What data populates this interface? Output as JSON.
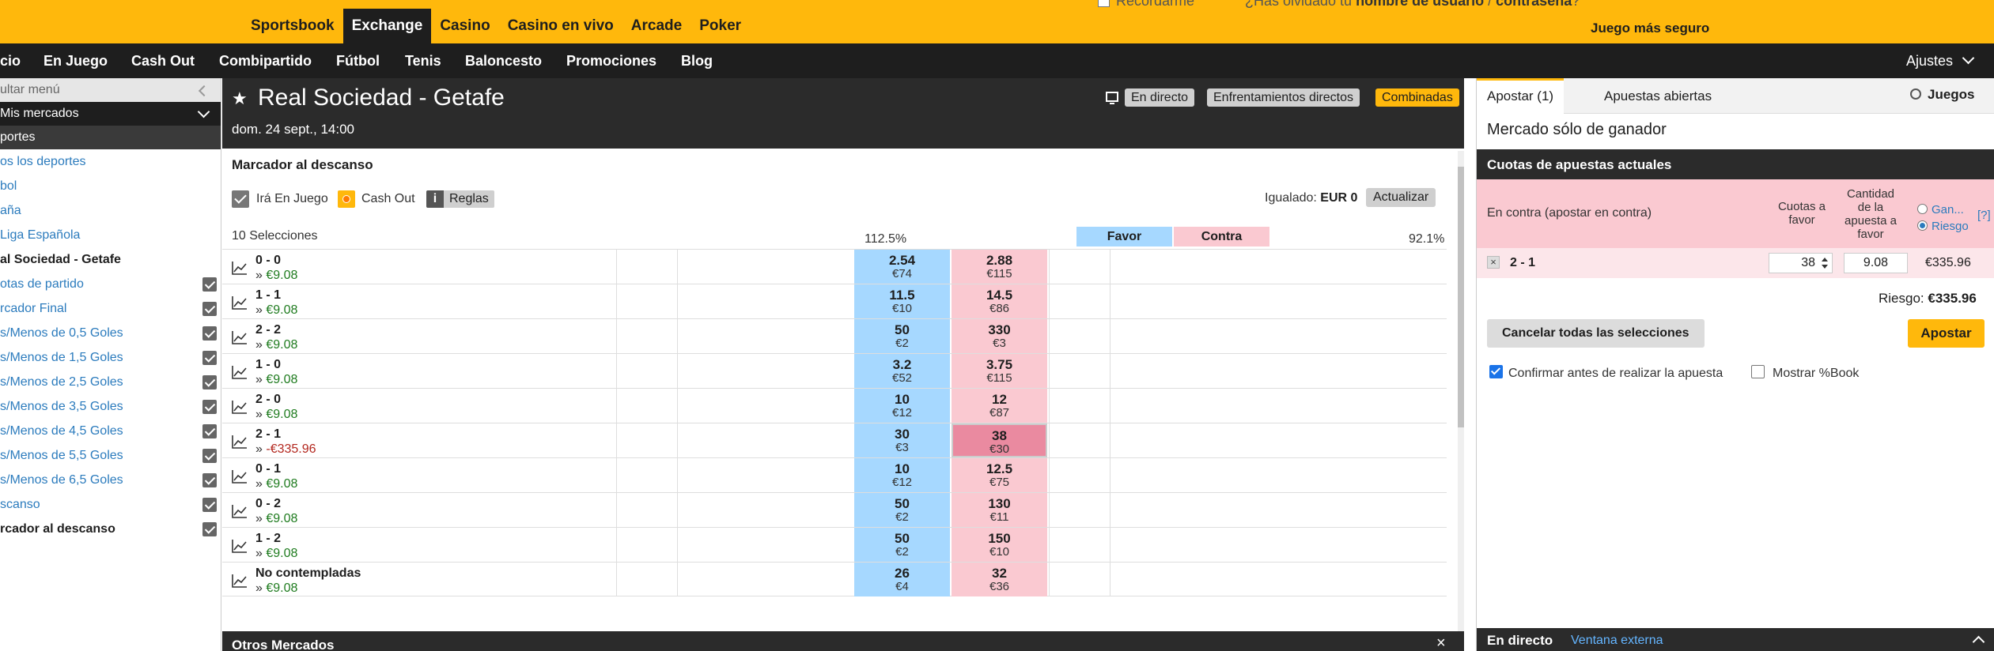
{
  "header": {
    "products": [
      "Sportsbook",
      "Exchange",
      "Casino",
      "Casino en vivo",
      "Arcade",
      "Poker"
    ],
    "active_product": "Exchange",
    "remember_me": "Recordarme",
    "forgot_prefix": "¿Has olvidado tu",
    "forgot_bold_1": "nombre de usuario",
    "forgot_sep": "/",
    "forgot_bold_2": "contraseña",
    "forgot_end": "?",
    "safer_gambling": "Juego más seguro"
  },
  "nav": {
    "items": [
      "cio",
      "En Juego",
      "Cash Out",
      "Combipartido",
      "Fútbol",
      "Tenis",
      "Baloncesto",
      "Promociones",
      "Blog"
    ],
    "settings": "Ajustes"
  },
  "sidebar": {
    "hide_menu": "ultar menú",
    "my_markets": "Mis mercados",
    "sports_header": "portes",
    "items": [
      {
        "label": "os los deportes",
        "checked": false,
        "bold": false
      },
      {
        "label": "bol",
        "checked": false,
        "bold": false
      },
      {
        "label": "aña",
        "checked": false,
        "bold": false
      },
      {
        "label": "Liga Española",
        "checked": false,
        "bold": false
      },
      {
        "label": "al Sociedad - Getafe",
        "checked": false,
        "bold": true
      },
      {
        "label": "otas de partido",
        "checked": true,
        "bold": false
      },
      {
        "label": "rcador Final",
        "checked": true,
        "bold": false
      },
      {
        "label": "s/Menos de 0,5 Goles",
        "checked": true,
        "bold": false
      },
      {
        "label": "s/Menos de 1,5 Goles",
        "checked": true,
        "bold": false
      },
      {
        "label": "s/Menos de 2,5 Goles",
        "checked": true,
        "bold": false
      },
      {
        "label": "s/Menos de 3,5 Goles",
        "checked": true,
        "bold": false
      },
      {
        "label": "s/Menos de 4,5 Goles",
        "checked": true,
        "bold": false
      },
      {
        "label": "s/Menos de 5,5 Goles",
        "checked": true,
        "bold": false
      },
      {
        "label": "s/Menos de 6,5 Goles",
        "checked": true,
        "bold": false
      },
      {
        "label": "scanso",
        "checked": true,
        "bold": false
      },
      {
        "label": "rcador al descanso",
        "checked": true,
        "bold": true
      }
    ]
  },
  "event": {
    "title": "Real Sociedad - Getafe",
    "date": "dom. 24 sept., 14:00",
    "buttons": {
      "live": "En directo",
      "h2h": "Enfrentamientos directos",
      "multiples": "Combinadas"
    }
  },
  "market": {
    "name": "Marcador al descanso",
    "in_play": "Irá En Juego",
    "cash_out": "Cash Out",
    "rules_icon": "i",
    "rules": "Reglas",
    "matched_label": "Igualado:",
    "matched_value": "EUR 0",
    "refresh": "Actualizar",
    "selections_count": "10 Selecciones",
    "back_overround": "112.5%",
    "lay_overround": "92.1%",
    "back_header": "Favor",
    "lay_header": "Contra",
    "runners": [
      {
        "name": "0 - 0",
        "pl": "€9.08",
        "pl_negative": false,
        "back_odds": "2.54",
        "back_size": "€74",
        "lay_odds": "2.88",
        "lay_size": "€115",
        "lay_selected": false
      },
      {
        "name": "1 - 1",
        "pl": "€9.08",
        "pl_negative": false,
        "back_odds": "11.5",
        "back_size": "€10",
        "lay_odds": "14.5",
        "lay_size": "€86",
        "lay_selected": false
      },
      {
        "name": "2 - 2",
        "pl": "€9.08",
        "pl_negative": false,
        "back_odds": "50",
        "back_size": "€2",
        "lay_odds": "330",
        "lay_size": "€3",
        "lay_selected": false
      },
      {
        "name": "1 - 0",
        "pl": "€9.08",
        "pl_negative": false,
        "back_odds": "3.2",
        "back_size": "€52",
        "lay_odds": "3.75",
        "lay_size": "€115",
        "lay_selected": false
      },
      {
        "name": "2 - 0",
        "pl": "€9.08",
        "pl_negative": false,
        "back_odds": "10",
        "back_size": "€12",
        "lay_odds": "12",
        "lay_size": "€87",
        "lay_selected": false
      },
      {
        "name": "2 - 1",
        "pl": "-€335.96",
        "pl_negative": true,
        "back_odds": "30",
        "back_size": "€3",
        "lay_odds": "38",
        "lay_size": "€30",
        "lay_selected": true
      },
      {
        "name": "0 - 1",
        "pl": "€9.08",
        "pl_negative": false,
        "back_odds": "10",
        "back_size": "€12",
        "lay_odds": "12.5",
        "lay_size": "€75",
        "lay_selected": false
      },
      {
        "name": "0 - 2",
        "pl": "€9.08",
        "pl_negative": false,
        "back_odds": "50",
        "back_size": "€2",
        "lay_odds": "130",
        "lay_size": "€11",
        "lay_selected": false
      },
      {
        "name": "1 - 2",
        "pl": "€9.08",
        "pl_negative": false,
        "back_odds": "50",
        "back_size": "€2",
        "lay_odds": "150",
        "lay_size": "€10",
        "lay_selected": false
      },
      {
        "name": "No contempladas",
        "pl": "€9.08",
        "pl_negative": false,
        "back_odds": "26",
        "back_size": "€4",
        "lay_odds": "32",
        "lay_size": "€36",
        "lay_selected": false
      }
    ],
    "pl_arrow": "»",
    "other_markets": "Otros Mercados",
    "close": "×"
  },
  "betslip": {
    "tab_place": "Apostar (1)",
    "tab_open": "Apuestas abiertas",
    "games": "Juegos",
    "market_title": "Mercado sólo de ganador",
    "current_odds": "Cuotas de apuestas actuales",
    "lay_title": "En contra (apostar en contra)",
    "col_odds": "Cuotas a favor",
    "col_stake": "Cantidad de la apuesta a favor",
    "radio_win": "Gan...",
    "radio_risk": "Riesgo",
    "radio_selected": "risk",
    "help": "[?]",
    "selection": "2 - 1",
    "remove": "×",
    "odds_value": "38",
    "stake_value": "9.08",
    "liability": "€335.96",
    "risk_label": "Riesgo:",
    "risk_value": "€335.96",
    "cancel_all": "Cancelar todas las selecciones",
    "place_bet": "Apostar",
    "confirm_label": "Confirmar antes de realizar la apuesta",
    "confirm_checked": true,
    "show_book_label": "Mostrar %Book",
    "show_book_checked": false,
    "live_label": "En directo",
    "external_window": "Ventana externa"
  },
  "colors": {
    "brand": "#ffb80c",
    "dark": "#1e1e1e",
    "back": "#a6d8ff",
    "lay": "#fac9d1",
    "lay_selected": "#ea8aa0",
    "link": "#2b7bbd",
    "profit": "#1e7b1e",
    "loss": "#b3271e"
  }
}
